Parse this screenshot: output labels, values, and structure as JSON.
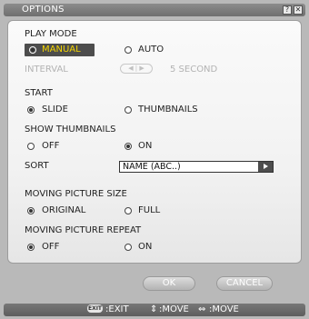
{
  "dialog": {
    "title": "OPTIONS",
    "help_glyph": "?",
    "close_glyph": "✕"
  },
  "play_mode": {
    "heading": "PLAY MODE",
    "manual": "MANUAL",
    "auto": "AUTO",
    "selected": "manual"
  },
  "interval": {
    "label": "INTERVAL",
    "stepper_glyph": "◀ | ▶",
    "value": "5 SECOND"
  },
  "start": {
    "heading": "START",
    "slide": "SLIDE",
    "thumbnails": "THUMBNAILS",
    "selected": "slide"
  },
  "show_thumbnails": {
    "heading": "SHOW THUMBNAILS",
    "off": "OFF",
    "on": "ON",
    "selected": "on"
  },
  "sort": {
    "label": "SORT",
    "value": "NAME (ABC..)"
  },
  "moving_picture_size": {
    "heading": "MOVING PICTURE SIZE",
    "original": "ORIGINAL",
    "full": "FULL",
    "selected": "original"
  },
  "moving_picture_repeat": {
    "heading": "MOVING PICTURE REPEAT",
    "off": "OFF",
    "on": "ON",
    "selected": "off"
  },
  "buttons": {
    "ok": "OK",
    "cancel": "CANCEL"
  },
  "status": {
    "exit_icon_text": "EXIT",
    "exit_label": ":EXIT",
    "updown_glyph": "⇕",
    "move_label": ":MOVE",
    "leftright_glyph": "⇔",
    "move_label_2": ":MOVE"
  },
  "colors": {
    "selection_bg": "#4d4d4d",
    "selection_text": "#f3d400",
    "panel_bg": "#f5f5f5",
    "frame_bg": "#b9b9b9"
  }
}
